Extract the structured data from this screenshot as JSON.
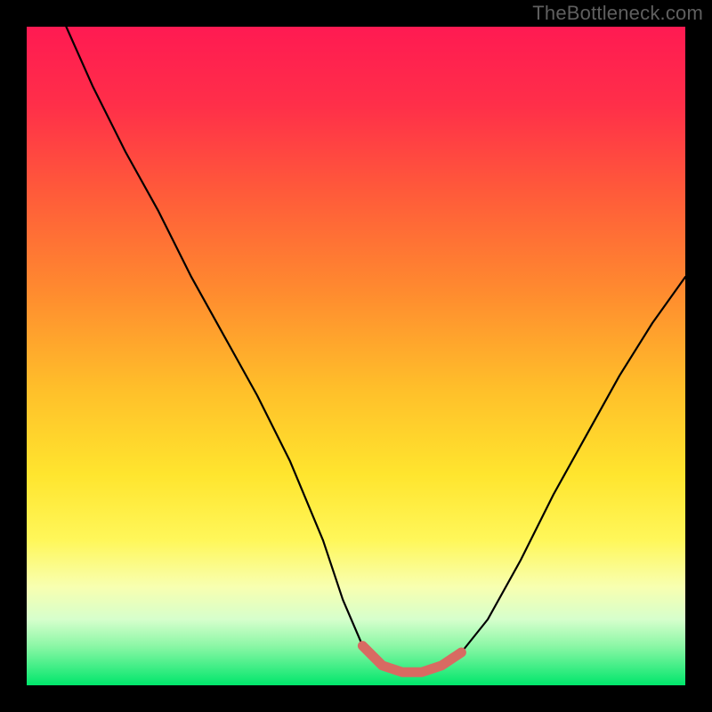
{
  "watermark": {
    "text": "TheBottleneck.com"
  },
  "colors": {
    "bg": "#000000",
    "watermark": "#5f5f5f",
    "curve": "#000000",
    "highlight": "#d86a62",
    "gradient_stops": [
      {
        "offset": 0.0,
        "color": "#ff1a52"
      },
      {
        "offset": 0.12,
        "color": "#ff2f49"
      },
      {
        "offset": 0.25,
        "color": "#ff5a3a"
      },
      {
        "offset": 0.4,
        "color": "#ff8a2f"
      },
      {
        "offset": 0.55,
        "color": "#ffbf2a"
      },
      {
        "offset": 0.68,
        "color": "#ffe52e"
      },
      {
        "offset": 0.78,
        "color": "#fff75a"
      },
      {
        "offset": 0.85,
        "color": "#f8ffb0"
      },
      {
        "offset": 0.9,
        "color": "#d6ffcc"
      },
      {
        "offset": 0.94,
        "color": "#8cf7a6"
      },
      {
        "offset": 1.0,
        "color": "#00e66b"
      }
    ]
  },
  "chart_data": {
    "type": "line",
    "title": "",
    "xlabel": "",
    "ylabel": "",
    "xlim": [
      0,
      100
    ],
    "ylim": [
      0,
      100
    ],
    "grid": false,
    "legend": false,
    "series": [
      {
        "name": "bottleneck_curve",
        "x": [
          6,
          10,
          15,
          20,
          25,
          30,
          35,
          40,
          45,
          48,
          51,
          54,
          57,
          60,
          63,
          66,
          70,
          75,
          80,
          85,
          90,
          95,
          100
        ],
        "y": [
          100,
          91,
          81,
          72,
          62,
          53,
          44,
          34,
          22,
          13,
          6,
          3,
          2,
          2,
          3,
          5,
          10,
          19,
          29,
          38,
          47,
          55,
          62
        ]
      }
    ],
    "highlight_segment": {
      "name": "trough",
      "x": [
        51,
        54,
        57,
        60,
        63,
        66
      ],
      "y": [
        6,
        3,
        2,
        2,
        3,
        5
      ]
    }
  }
}
